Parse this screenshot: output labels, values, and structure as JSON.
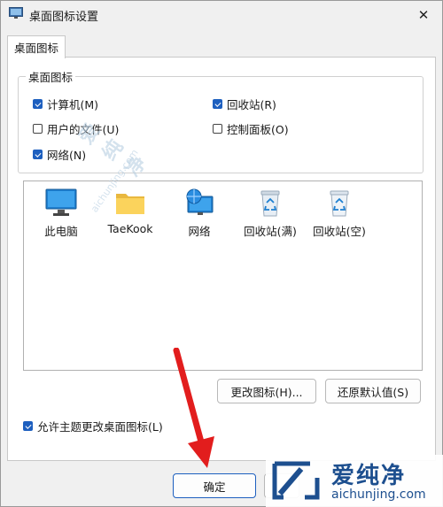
{
  "window": {
    "title": "桌面图标设置"
  },
  "tab": {
    "label": "桌面图标"
  },
  "group": {
    "label": "桌面图标",
    "checkboxes": [
      {
        "label": "计算机(M)",
        "checked": true
      },
      {
        "label": "回收站(R)",
        "checked": true
      },
      {
        "label": "用户的文件(U)",
        "checked": false
      },
      {
        "label": "控制面板(O)",
        "checked": false
      },
      {
        "label": "网络(N)",
        "checked": true
      }
    ]
  },
  "icons": [
    {
      "label": "此电脑",
      "icon": "monitor-icon"
    },
    {
      "label": "TaeKook",
      "icon": "folder-icon"
    },
    {
      "label": "网络",
      "icon": "network-icon"
    },
    {
      "label": "回收站(满)",
      "icon": "recycle-bin-full-icon"
    },
    {
      "label": "回收站(空)",
      "icon": "recycle-bin-empty-icon"
    }
  ],
  "buttons": {
    "change_icon": "更改图标(H)...",
    "restore_default": "还原默认值(S)",
    "ok": "确定"
  },
  "allow_themes": {
    "label": "允许主题更改桌面图标(L)",
    "checked": true
  },
  "watermark": {
    "brand": "爱纯净",
    "url": "aichunjing.com"
  },
  "colors": {
    "accent": "#1d5fbf",
    "arrow": "#e21d1d"
  }
}
